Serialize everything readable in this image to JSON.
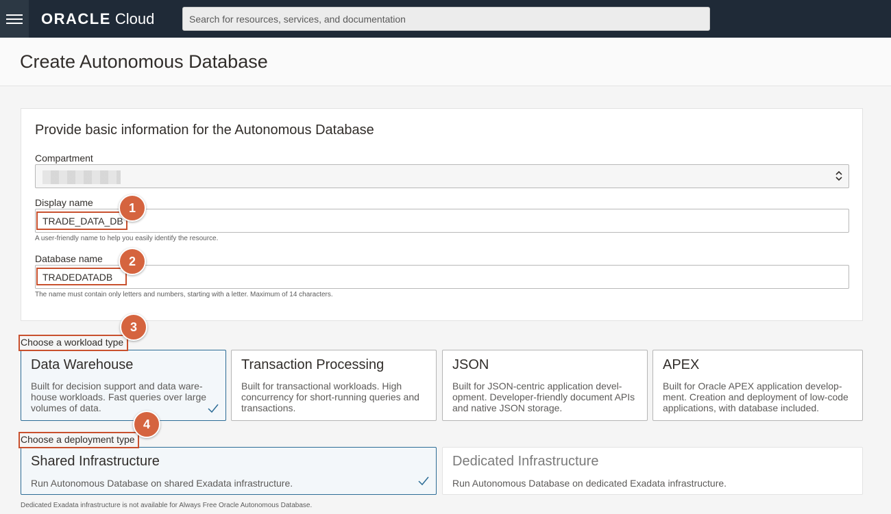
{
  "topbar": {
    "brand_oracle": "ORACLE",
    "brand_cloud": "Cloud",
    "search_placeholder": "Search for resources, services, and documentation",
    "menu_icon": "hamburger-menu-icon"
  },
  "page": {
    "title": "Create Autonomous Database"
  },
  "basic_info": {
    "heading": "Provide basic information for the Autonomous Database",
    "compartment_label": "Compartment",
    "display_name_label": "Display name",
    "display_name_value": "TRADE_DATA_DB",
    "display_name_hint": "A user-friendly name to help you easily identify the resource.",
    "database_name_label": "Database name",
    "database_name_value": "TRADEDATADB",
    "database_name_hint": "The name must contain only letters and numbers, starting with a letter. Maximum of 14 characters."
  },
  "workload": {
    "label": "Choose a workload type",
    "options": [
      {
        "title": "Data Warehouse",
        "desc": "Built for decision support and data ware-house workloads. Fast queries over large volumes of data.",
        "selected": true
      },
      {
        "title": "Transaction Processing",
        "desc": "Built for transactional workloads. High concurrency for short-running queries and transactions.",
        "selected": false
      },
      {
        "title": "JSON",
        "desc": "Built for JSON-centric application devel-opment. Developer-friendly document APIs and native JSON storage.",
        "selected": false
      },
      {
        "title": "APEX",
        "desc": "Built for Oracle APEX application develop-ment. Creation and deployment of low-code applications, with database included.",
        "selected": false
      }
    ]
  },
  "deployment": {
    "label": "Choose a deployment type",
    "options": [
      {
        "title": "Shared Infrastructure",
        "desc": "Run Autonomous Database on shared Exadata infrastructure.",
        "selected": true,
        "disabled": false
      },
      {
        "title": "Dedicated Infrastructure",
        "desc": "Run Autonomous Database on dedicated Exadata infrastructure.",
        "selected": false,
        "disabled": true
      }
    ],
    "footnote": "Dedicated Exadata infrastructure is not available for Always Free Oracle Autonomous Database."
  },
  "annotations": [
    "1",
    "2",
    "3",
    "4"
  ],
  "colors": {
    "topbar": "#1f2a37",
    "annotation": "#d5643f",
    "selected_border": "#2b6b95"
  }
}
